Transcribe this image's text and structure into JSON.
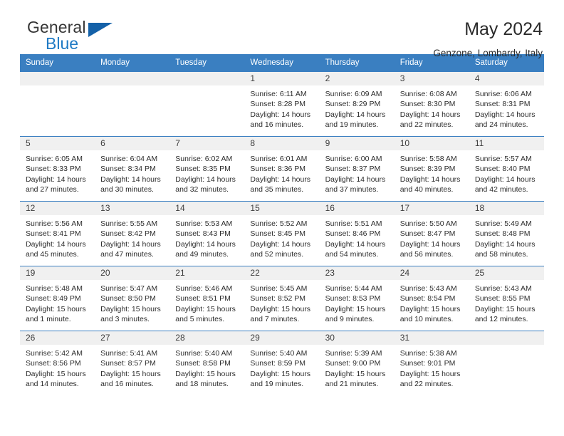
{
  "brand": {
    "name_part1": "General",
    "name_part2": "Blue",
    "flag_icon": "triangle-flag-icon"
  },
  "header": {
    "title": "May 2024",
    "subtitle": "Genzone, Lombardy, Italy"
  },
  "colors": {
    "header_blue": "#3a7fc1",
    "brand_blue": "#1f7ac4",
    "flag_blue": "#1461a8",
    "daynum_bg": "#f0f0f0",
    "text": "#2c2c2c"
  },
  "weekdays": [
    "Sunday",
    "Monday",
    "Tuesday",
    "Wednesday",
    "Thursday",
    "Friday",
    "Saturday"
  ],
  "weeks": [
    [
      {
        "day": "",
        "sunrise": "",
        "sunset": "",
        "daylight": ""
      },
      {
        "day": "",
        "sunrise": "",
        "sunset": "",
        "daylight": ""
      },
      {
        "day": "",
        "sunrise": "",
        "sunset": "",
        "daylight": ""
      },
      {
        "day": "1",
        "sunrise": "Sunrise: 6:11 AM",
        "sunset": "Sunset: 8:28 PM",
        "daylight": "Daylight: 14 hours and 16 minutes."
      },
      {
        "day": "2",
        "sunrise": "Sunrise: 6:09 AM",
        "sunset": "Sunset: 8:29 PM",
        "daylight": "Daylight: 14 hours and 19 minutes."
      },
      {
        "day": "3",
        "sunrise": "Sunrise: 6:08 AM",
        "sunset": "Sunset: 8:30 PM",
        "daylight": "Daylight: 14 hours and 22 minutes."
      },
      {
        "day": "4",
        "sunrise": "Sunrise: 6:06 AM",
        "sunset": "Sunset: 8:31 PM",
        "daylight": "Daylight: 14 hours and 24 minutes."
      }
    ],
    [
      {
        "day": "5",
        "sunrise": "Sunrise: 6:05 AM",
        "sunset": "Sunset: 8:33 PM",
        "daylight": "Daylight: 14 hours and 27 minutes."
      },
      {
        "day": "6",
        "sunrise": "Sunrise: 6:04 AM",
        "sunset": "Sunset: 8:34 PM",
        "daylight": "Daylight: 14 hours and 30 minutes."
      },
      {
        "day": "7",
        "sunrise": "Sunrise: 6:02 AM",
        "sunset": "Sunset: 8:35 PM",
        "daylight": "Daylight: 14 hours and 32 minutes."
      },
      {
        "day": "8",
        "sunrise": "Sunrise: 6:01 AM",
        "sunset": "Sunset: 8:36 PM",
        "daylight": "Daylight: 14 hours and 35 minutes."
      },
      {
        "day": "9",
        "sunrise": "Sunrise: 6:00 AM",
        "sunset": "Sunset: 8:37 PM",
        "daylight": "Daylight: 14 hours and 37 minutes."
      },
      {
        "day": "10",
        "sunrise": "Sunrise: 5:58 AM",
        "sunset": "Sunset: 8:39 PM",
        "daylight": "Daylight: 14 hours and 40 minutes."
      },
      {
        "day": "11",
        "sunrise": "Sunrise: 5:57 AM",
        "sunset": "Sunset: 8:40 PM",
        "daylight": "Daylight: 14 hours and 42 minutes."
      }
    ],
    [
      {
        "day": "12",
        "sunrise": "Sunrise: 5:56 AM",
        "sunset": "Sunset: 8:41 PM",
        "daylight": "Daylight: 14 hours and 45 minutes."
      },
      {
        "day": "13",
        "sunrise": "Sunrise: 5:55 AM",
        "sunset": "Sunset: 8:42 PM",
        "daylight": "Daylight: 14 hours and 47 minutes."
      },
      {
        "day": "14",
        "sunrise": "Sunrise: 5:53 AM",
        "sunset": "Sunset: 8:43 PM",
        "daylight": "Daylight: 14 hours and 49 minutes."
      },
      {
        "day": "15",
        "sunrise": "Sunrise: 5:52 AM",
        "sunset": "Sunset: 8:45 PM",
        "daylight": "Daylight: 14 hours and 52 minutes."
      },
      {
        "day": "16",
        "sunrise": "Sunrise: 5:51 AM",
        "sunset": "Sunset: 8:46 PM",
        "daylight": "Daylight: 14 hours and 54 minutes."
      },
      {
        "day": "17",
        "sunrise": "Sunrise: 5:50 AM",
        "sunset": "Sunset: 8:47 PM",
        "daylight": "Daylight: 14 hours and 56 minutes."
      },
      {
        "day": "18",
        "sunrise": "Sunrise: 5:49 AM",
        "sunset": "Sunset: 8:48 PM",
        "daylight": "Daylight: 14 hours and 58 minutes."
      }
    ],
    [
      {
        "day": "19",
        "sunrise": "Sunrise: 5:48 AM",
        "sunset": "Sunset: 8:49 PM",
        "daylight": "Daylight: 15 hours and 1 minute."
      },
      {
        "day": "20",
        "sunrise": "Sunrise: 5:47 AM",
        "sunset": "Sunset: 8:50 PM",
        "daylight": "Daylight: 15 hours and 3 minutes."
      },
      {
        "day": "21",
        "sunrise": "Sunrise: 5:46 AM",
        "sunset": "Sunset: 8:51 PM",
        "daylight": "Daylight: 15 hours and 5 minutes."
      },
      {
        "day": "22",
        "sunrise": "Sunrise: 5:45 AM",
        "sunset": "Sunset: 8:52 PM",
        "daylight": "Daylight: 15 hours and 7 minutes."
      },
      {
        "day": "23",
        "sunrise": "Sunrise: 5:44 AM",
        "sunset": "Sunset: 8:53 PM",
        "daylight": "Daylight: 15 hours and 9 minutes."
      },
      {
        "day": "24",
        "sunrise": "Sunrise: 5:43 AM",
        "sunset": "Sunset: 8:54 PM",
        "daylight": "Daylight: 15 hours and 10 minutes."
      },
      {
        "day": "25",
        "sunrise": "Sunrise: 5:43 AM",
        "sunset": "Sunset: 8:55 PM",
        "daylight": "Daylight: 15 hours and 12 minutes."
      }
    ],
    [
      {
        "day": "26",
        "sunrise": "Sunrise: 5:42 AM",
        "sunset": "Sunset: 8:56 PM",
        "daylight": "Daylight: 15 hours and 14 minutes."
      },
      {
        "day": "27",
        "sunrise": "Sunrise: 5:41 AM",
        "sunset": "Sunset: 8:57 PM",
        "daylight": "Daylight: 15 hours and 16 minutes."
      },
      {
        "day": "28",
        "sunrise": "Sunrise: 5:40 AM",
        "sunset": "Sunset: 8:58 PM",
        "daylight": "Daylight: 15 hours and 18 minutes."
      },
      {
        "day": "29",
        "sunrise": "Sunrise: 5:40 AM",
        "sunset": "Sunset: 8:59 PM",
        "daylight": "Daylight: 15 hours and 19 minutes."
      },
      {
        "day": "30",
        "sunrise": "Sunrise: 5:39 AM",
        "sunset": "Sunset: 9:00 PM",
        "daylight": "Daylight: 15 hours and 21 minutes."
      },
      {
        "day": "31",
        "sunrise": "Sunrise: 5:38 AM",
        "sunset": "Sunset: 9:01 PM",
        "daylight": "Daylight: 15 hours and 22 minutes."
      },
      {
        "day": "",
        "sunrise": "",
        "sunset": "",
        "daylight": ""
      }
    ]
  ]
}
